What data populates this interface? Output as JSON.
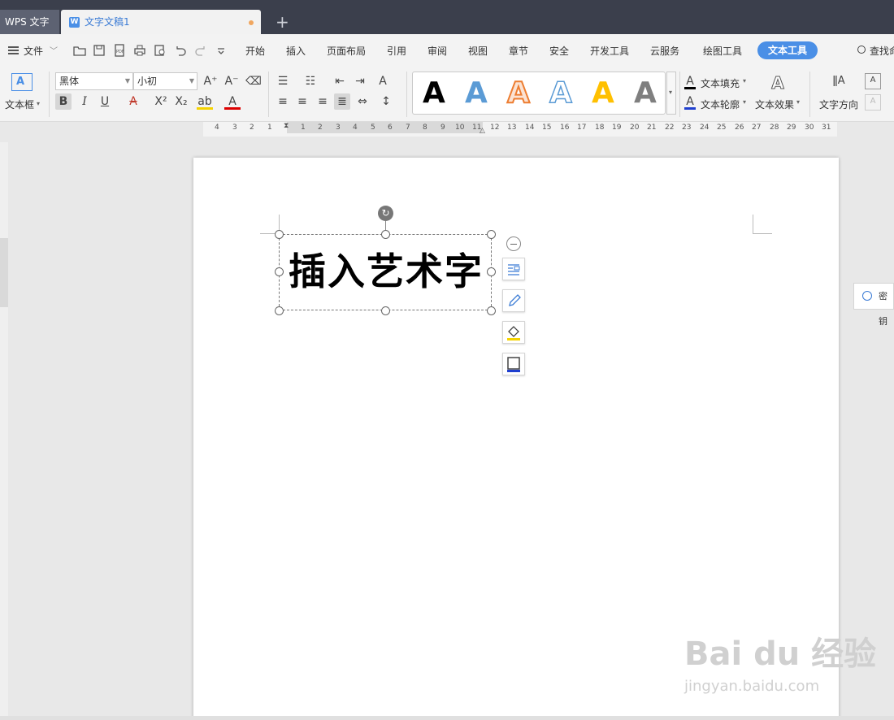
{
  "titlebar": {
    "app_name": "WPS 文字",
    "doc_tab": "文字文稿1",
    "new_tab": "+"
  },
  "menubar": {
    "file": "文件",
    "items": [
      "开始",
      "插入",
      "页面布局",
      "引用",
      "审阅",
      "视图",
      "章节",
      "安全",
      "开发工具",
      "云服务",
      "绘图工具"
    ],
    "active": "文本工具",
    "search": "查找命"
  },
  "ribbon": {
    "textbox_label": "文本框",
    "font_name": "黑体",
    "font_size": "小初",
    "art_sample": "A",
    "text_fill": "文本填充",
    "text_outline": "文本轮廓",
    "text_effect": "文本效果",
    "text_direction": "文字方向"
  },
  "ruler": {
    "ticks": [
      "4",
      "3",
      "2",
      "1",
      "1",
      "2",
      "3",
      "4",
      "5",
      "6",
      "7",
      "8",
      "9",
      "10",
      "11",
      "12",
      "13",
      "14",
      "15",
      "16",
      "17",
      "18",
      "19",
      "20",
      "21",
      "22",
      "23",
      "24",
      "25",
      "26",
      "27",
      "28",
      "29",
      "30",
      "31"
    ]
  },
  "document": {
    "wordart_text": "插入艺术字"
  },
  "side_panel": {
    "label": "密钥"
  },
  "watermark": {
    "main": "Bai du 经验",
    "sub": "jingyan.baidu.com"
  },
  "colors": {
    "accent": "#4a8fe6",
    "titlebar": "#3b3f4c",
    "gallery": [
      "#000000",
      "#5b9bd5",
      "#ed7d31",
      "#ffffff",
      "#ffc000",
      "#7f7f7f"
    ]
  }
}
